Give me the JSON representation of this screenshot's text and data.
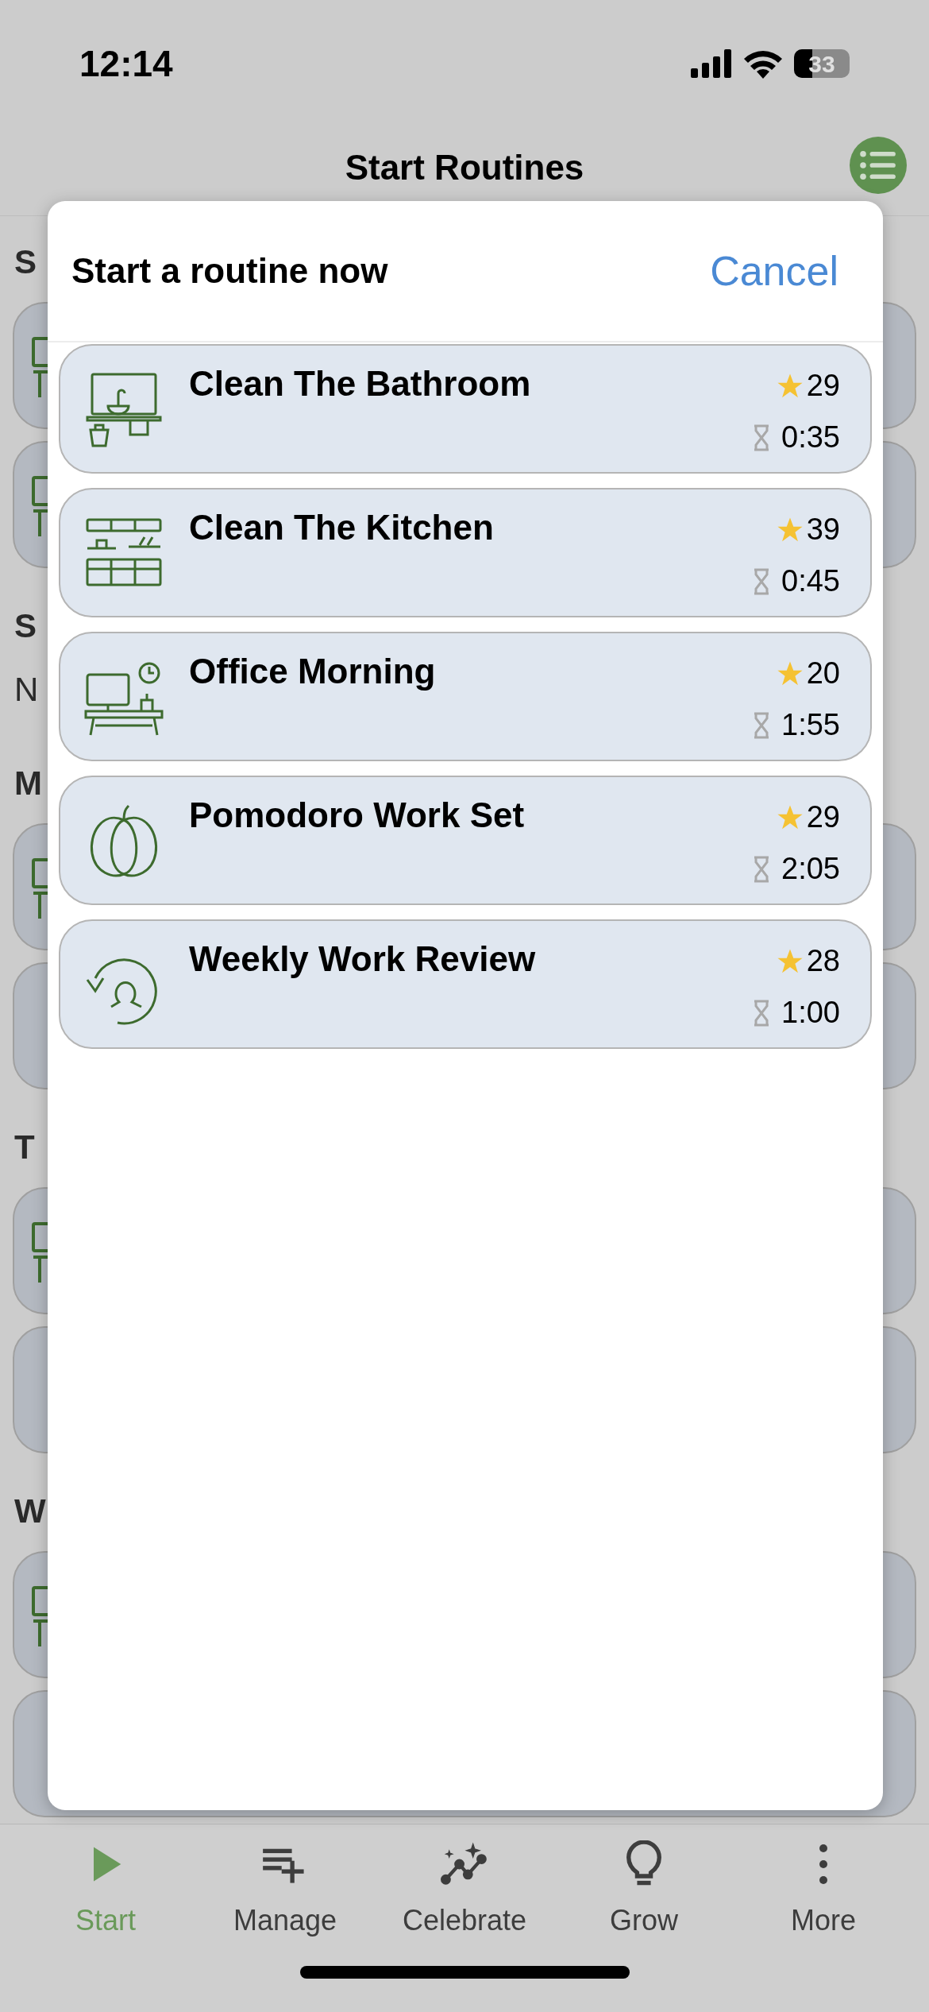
{
  "status_bar": {
    "time": "12:14",
    "battery": "33"
  },
  "nav": {
    "title": "Start Routines"
  },
  "background": [
    {
      "kind": "heading",
      "text": "S"
    },
    {
      "kind": "card",
      "has_icon": true
    },
    {
      "kind": "card",
      "has_icon": true
    },
    {
      "kind": "heading",
      "text": "S"
    },
    {
      "kind": "text",
      "text": "N"
    },
    {
      "kind": "heading",
      "text": "M"
    },
    {
      "kind": "card",
      "has_icon": true
    },
    {
      "kind": "card",
      "has_icon": false
    },
    {
      "kind": "heading",
      "text": "T"
    },
    {
      "kind": "card",
      "has_icon": true
    },
    {
      "kind": "card",
      "has_icon": false
    },
    {
      "kind": "heading",
      "text": "W"
    },
    {
      "kind": "card",
      "has_icon": true
    },
    {
      "kind": "card",
      "has_icon": false
    }
  ],
  "sheet": {
    "title": "Start a routine now",
    "cancel": "Cancel",
    "routines": [
      {
        "kind": "bathroom",
        "title": "Clean The Bathroom",
        "score": "29",
        "duration": "0:35"
      },
      {
        "kind": "kitchen",
        "title": "Clean The Kitchen",
        "score": "39",
        "duration": "0:45"
      },
      {
        "kind": "office",
        "title": "Office Morning",
        "score": "20",
        "duration": "1:55"
      },
      {
        "kind": "pumpkin",
        "title": "Pomodoro Work Set",
        "score": "29",
        "duration": "2:05"
      },
      {
        "kind": "review",
        "title": "Weekly Work Review",
        "score": "28",
        "duration": "1:00"
      }
    ]
  },
  "tab_bar": [
    {
      "kind": "play",
      "label": "Start",
      "selected": true
    },
    {
      "kind": "list-add",
      "label": "Manage",
      "selected": false
    },
    {
      "kind": "chart",
      "label": "Celebrate",
      "selected": false
    },
    {
      "kind": "bulb",
      "label": "Grow",
      "selected": false
    },
    {
      "kind": "dots",
      "label": "More",
      "selected": false
    }
  ]
}
